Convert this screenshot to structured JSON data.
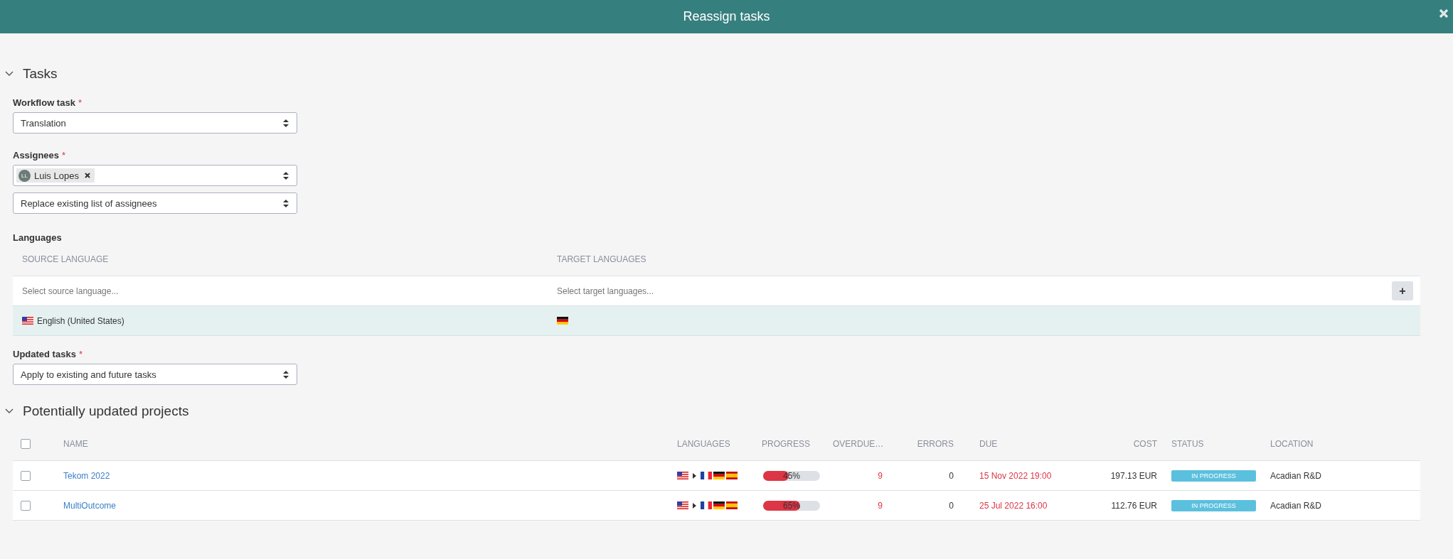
{
  "dialog": {
    "title": "Reassign tasks"
  },
  "tasks": {
    "heading": "Tasks",
    "expanded": true,
    "workflow_task": {
      "label": "Workflow task",
      "required": "*",
      "value": "Translation"
    },
    "assignees": {
      "label": "Assignees",
      "required": "*",
      "chips": [
        {
          "initials": "LL",
          "name": "Luis Lopes"
        }
      ],
      "mode": "Replace existing list of assignees"
    },
    "languages": {
      "label": "Languages",
      "columns": [
        "SOURCE LANGUAGE",
        "TARGET LANGUAGES"
      ],
      "source_placeholder": "Select source language...",
      "target_placeholder": "Select target languages...",
      "add": "+",
      "rows": [
        {
          "source": "English (United States)",
          "source_flag": {
            "kind": "us"
          },
          "target_flags": [
            {
              "kind": "de"
            }
          ]
        }
      ]
    },
    "updated_tasks": {
      "label": "Updated tasks",
      "required": "*",
      "value": "Apply to existing and future tasks"
    }
  },
  "projects": {
    "heading": "Potentially updated projects",
    "expanded": true,
    "select_all": {
      "checked": false
    },
    "columns": [
      "NAME",
      "LANGUAGES",
      "PROGRESS",
      "OVERDUE…",
      "ERRORS",
      "DUE",
      "COST",
      "STATUS",
      "LOCATION"
    ],
    "rows": [
      {
        "checked": false,
        "name": "Tekom 2022",
        "source_flag": {
          "kind": "us"
        },
        "target_flags": [
          {
            "kind": "fr"
          },
          {
            "kind": "de"
          },
          {
            "kind": "es"
          }
        ],
        "level": 0.45,
        "progress": "45%",
        "overdue": "9",
        "errors": "0",
        "due": "15 Nov 2022 19:00",
        "cost": "197.13 EUR",
        "status": "IN PROGRESS",
        "color": "#5bc0de",
        "location": "Acadian R&D"
      },
      {
        "checked": false,
        "name": "MultiOutcome",
        "source_flag": {
          "kind": "us"
        },
        "target_flags": [
          {
            "kind": "fr"
          },
          {
            "kind": "de"
          },
          {
            "kind": "es"
          }
        ],
        "level": 0.65,
        "progress": "65%",
        "overdue": "9",
        "errors": "0",
        "due": "25 Jul 2022 16:00",
        "cost": "112.76 EUR",
        "status": "IN PROGRESS",
        "color": "#5bc0de",
        "location": "Acadian R&D"
      }
    ]
  }
}
